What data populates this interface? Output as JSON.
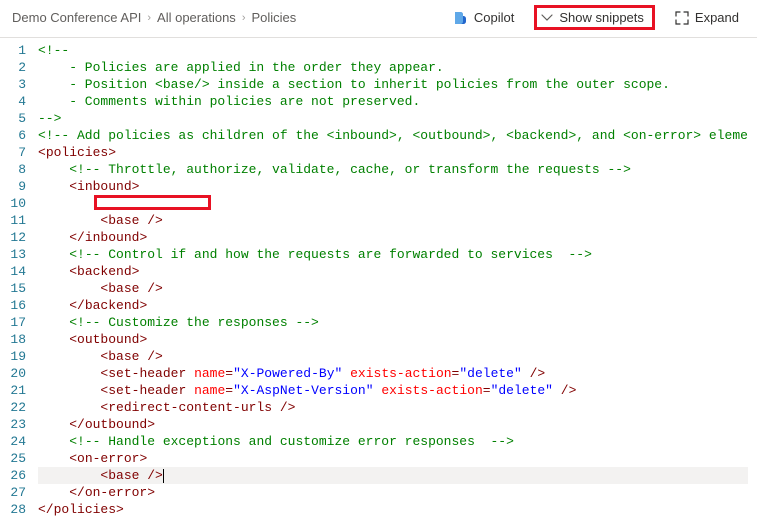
{
  "breadcrumb": {
    "item1": "Demo Conference API",
    "item2": "All operations",
    "item3": "Policies"
  },
  "toolbar": {
    "copilot_label": "Copilot",
    "show_snippets_label": "Show snippets",
    "expand_label": "Expand"
  },
  "editor": {
    "lines": [
      {
        "n": "1",
        "seg": [
          {
            "t": "<!--",
            "c": "c-comment"
          }
        ]
      },
      {
        "n": "2",
        "seg": [
          {
            "t": "    - Policies are applied in the order they appear.",
            "c": "c-comment"
          }
        ]
      },
      {
        "n": "3",
        "seg": [
          {
            "t": "    - Position <base/> inside a section to inherit policies from the outer scope.",
            "c": "c-comment"
          }
        ]
      },
      {
        "n": "4",
        "seg": [
          {
            "t": "    - Comments within policies are not preserved.",
            "c": "c-comment"
          }
        ]
      },
      {
        "n": "5",
        "seg": [
          {
            "t": "-->",
            "c": "c-comment"
          }
        ]
      },
      {
        "n": "6",
        "seg": [
          {
            "t": "<!-- Add policies as children of the <inbound>, <outbound>, <backend>, and <on-error> eleme",
            "c": "c-comment"
          }
        ]
      },
      {
        "n": "7",
        "seg": [
          {
            "t": "<",
            "c": "c-punct"
          },
          {
            "t": "policies",
            "c": "c-tag"
          },
          {
            "t": ">",
            "c": "c-punct"
          }
        ]
      },
      {
        "n": "8",
        "seg": [
          {
            "t": "    ",
            "c": ""
          },
          {
            "t": "<!-- Throttle, authorize, validate, cache, or transform the requests -->",
            "c": "c-comment"
          }
        ]
      },
      {
        "n": "9",
        "seg": [
          {
            "t": "    ",
            "c": ""
          },
          {
            "t": "<",
            "c": "c-punct"
          },
          {
            "t": "inbound",
            "c": "c-tag"
          },
          {
            "t": ">",
            "c": "c-punct"
          }
        ]
      },
      {
        "n": "10",
        "seg": [
          {
            "t": " ",
            "c": ""
          }
        ],
        "redbox": true
      },
      {
        "n": "11",
        "seg": [
          {
            "t": "        ",
            "c": ""
          },
          {
            "t": "<",
            "c": "c-punct"
          },
          {
            "t": "base",
            "c": "c-tag"
          },
          {
            "t": " />",
            "c": "c-punct"
          }
        ]
      },
      {
        "n": "12",
        "seg": [
          {
            "t": "    ",
            "c": ""
          },
          {
            "t": "</",
            "c": "c-punct"
          },
          {
            "t": "inbound",
            "c": "c-tag"
          },
          {
            "t": ">",
            "c": "c-punct"
          }
        ]
      },
      {
        "n": "13",
        "seg": [
          {
            "t": "    ",
            "c": ""
          },
          {
            "t": "<!-- Control if and how the requests are forwarded to services  -->",
            "c": "c-comment"
          }
        ]
      },
      {
        "n": "14",
        "seg": [
          {
            "t": "    ",
            "c": ""
          },
          {
            "t": "<",
            "c": "c-punct"
          },
          {
            "t": "backend",
            "c": "c-tag"
          },
          {
            "t": ">",
            "c": "c-punct"
          }
        ]
      },
      {
        "n": "15",
        "seg": [
          {
            "t": "        ",
            "c": ""
          },
          {
            "t": "<",
            "c": "c-punct"
          },
          {
            "t": "base",
            "c": "c-tag"
          },
          {
            "t": " />",
            "c": "c-punct"
          }
        ]
      },
      {
        "n": "16",
        "seg": [
          {
            "t": "    ",
            "c": ""
          },
          {
            "t": "</",
            "c": "c-punct"
          },
          {
            "t": "backend",
            "c": "c-tag"
          },
          {
            "t": ">",
            "c": "c-punct"
          }
        ]
      },
      {
        "n": "17",
        "seg": [
          {
            "t": "    ",
            "c": ""
          },
          {
            "t": "<!-- Customize the responses -->",
            "c": "c-comment"
          }
        ]
      },
      {
        "n": "18",
        "seg": [
          {
            "t": "    ",
            "c": ""
          },
          {
            "t": "<",
            "c": "c-punct"
          },
          {
            "t": "outbound",
            "c": "c-tag"
          },
          {
            "t": ">",
            "c": "c-punct"
          }
        ]
      },
      {
        "n": "19",
        "seg": [
          {
            "t": "        ",
            "c": ""
          },
          {
            "t": "<",
            "c": "c-punct"
          },
          {
            "t": "base",
            "c": "c-tag"
          },
          {
            "t": " />",
            "c": "c-punct"
          }
        ]
      },
      {
        "n": "20",
        "seg": [
          {
            "t": "        ",
            "c": ""
          },
          {
            "t": "<",
            "c": "c-punct"
          },
          {
            "t": "set-header",
            "c": "c-tag"
          },
          {
            "t": " ",
            "c": ""
          },
          {
            "t": "name",
            "c": "c-attr"
          },
          {
            "t": "=",
            "c": "c-punct"
          },
          {
            "t": "\"X-Powered-By\"",
            "c": "c-str"
          },
          {
            "t": " ",
            "c": ""
          },
          {
            "t": "exists-action",
            "c": "c-attr"
          },
          {
            "t": "=",
            "c": "c-punct"
          },
          {
            "t": "\"delete\"",
            "c": "c-str"
          },
          {
            "t": " />",
            "c": "c-punct"
          }
        ]
      },
      {
        "n": "21",
        "seg": [
          {
            "t": "        ",
            "c": ""
          },
          {
            "t": "<",
            "c": "c-punct"
          },
          {
            "t": "set-header",
            "c": "c-tag"
          },
          {
            "t": " ",
            "c": ""
          },
          {
            "t": "name",
            "c": "c-attr"
          },
          {
            "t": "=",
            "c": "c-punct"
          },
          {
            "t": "\"X-AspNet-Version\"",
            "c": "c-str"
          },
          {
            "t": " ",
            "c": ""
          },
          {
            "t": "exists-action",
            "c": "c-attr"
          },
          {
            "t": "=",
            "c": "c-punct"
          },
          {
            "t": "\"delete\"",
            "c": "c-str"
          },
          {
            "t": " />",
            "c": "c-punct"
          }
        ]
      },
      {
        "n": "22",
        "seg": [
          {
            "t": "        ",
            "c": ""
          },
          {
            "t": "<",
            "c": "c-punct"
          },
          {
            "t": "redirect-content-urls",
            "c": "c-tag"
          },
          {
            "t": " />",
            "c": "c-punct"
          }
        ]
      },
      {
        "n": "23",
        "seg": [
          {
            "t": "    ",
            "c": ""
          },
          {
            "t": "</",
            "c": "c-punct"
          },
          {
            "t": "outbound",
            "c": "c-tag"
          },
          {
            "t": ">",
            "c": "c-punct"
          }
        ]
      },
      {
        "n": "24",
        "seg": [
          {
            "t": "    ",
            "c": ""
          },
          {
            "t": "<!-- Handle exceptions and customize error responses  -->",
            "c": "c-comment"
          }
        ]
      },
      {
        "n": "25",
        "seg": [
          {
            "t": "    ",
            "c": ""
          },
          {
            "t": "<",
            "c": "c-punct"
          },
          {
            "t": "on-error",
            "c": "c-tag"
          },
          {
            "t": ">",
            "c": "c-punct"
          }
        ]
      },
      {
        "n": "26",
        "seg": [
          {
            "t": "        ",
            "c": ""
          },
          {
            "t": "<",
            "c": "c-punct"
          },
          {
            "t": "base",
            "c": "c-tag"
          },
          {
            "t": " />",
            "c": "c-punct"
          }
        ],
        "current": true,
        "cursor": true
      },
      {
        "n": "27",
        "seg": [
          {
            "t": "    ",
            "c": ""
          },
          {
            "t": "</",
            "c": "c-punct"
          },
          {
            "t": "on-error",
            "c": "c-tag"
          },
          {
            "t": ">",
            "c": "c-punct"
          }
        ]
      },
      {
        "n": "28",
        "seg": [
          {
            "t": "</",
            "c": "c-punct"
          },
          {
            "t": "policies",
            "c": "c-tag"
          },
          {
            "t": ">",
            "c": "c-punct"
          }
        ]
      }
    ]
  }
}
